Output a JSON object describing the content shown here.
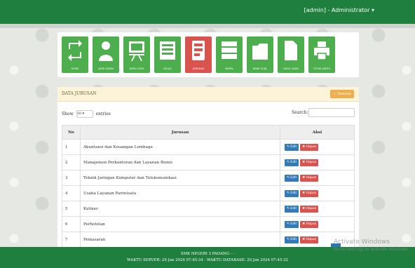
{
  "header": {
    "user_label": "[admin] - Administrator ▾"
  },
  "menu": [
    {
      "label": "HOME",
      "icon": "refresh-icon"
    },
    {
      "label": "DATA SISWA",
      "icon": "user-icon"
    },
    {
      "label": "DATA GURU",
      "icon": "presentation-icon"
    },
    {
      "label": "KELAS",
      "icon": "list-icon"
    },
    {
      "label": "JURUSAN",
      "icon": "tasks-icon",
      "active": true
    },
    {
      "label": "MAPEL",
      "icon": "server-icon"
    },
    {
      "label": "BANK SOAL",
      "icon": "folder-icon"
    },
    {
      "label": "HASIL UJIAN",
      "icon": "file-icon"
    },
    {
      "label": "CETAK KARTU",
      "icon": "printer-icon"
    }
  ],
  "panel": {
    "title": "DATA JURUSAN",
    "add_label": "+ Tambah",
    "show_label": "Show",
    "entries_value": "10",
    "entries_label": "entries",
    "search_label": "Search:",
    "search_value": ""
  },
  "table": {
    "headers": [
      "No",
      "Jurusan",
      "Aksi"
    ],
    "edit_label": "✎ Edit",
    "hapus_label": "✖ Hapus",
    "rows": [
      {
        "no": "1",
        "jurusan": "Akuntansi dan Keuangan Lembaga"
      },
      {
        "no": "2",
        "jurusan": "Manajemen Perkantoran dan Layanan Bisnis"
      },
      {
        "no": "3",
        "jurusan": "Teknik Jaringan Komputer dan Telekomunikasi"
      },
      {
        "no": "4",
        "jurusan": "Usaha Layanan Pariwisata"
      },
      {
        "no": "5",
        "jurusan": "Kuliner"
      },
      {
        "no": "6",
        "jurusan": "Perhotelan"
      },
      {
        "no": "7",
        "jurusan": "Pemasaran"
      }
    ]
  },
  "footer": {
    "line1": "SMK NEGERI 3 PADANG - -",
    "line2": "WAKTU SERVER: 29 Jan 2024 07:45:34 - WAKTU DATABASE: 29 Jan 2024 07:45:32"
  },
  "watermark": {
    "line1": "Activate Windows",
    "line2": "Go to Settings to activate Windows."
  },
  "colors": {
    "brand_green": "#1e7f3e",
    "tile_green": "#4cae4c",
    "tile_active": "#d9534f"
  }
}
